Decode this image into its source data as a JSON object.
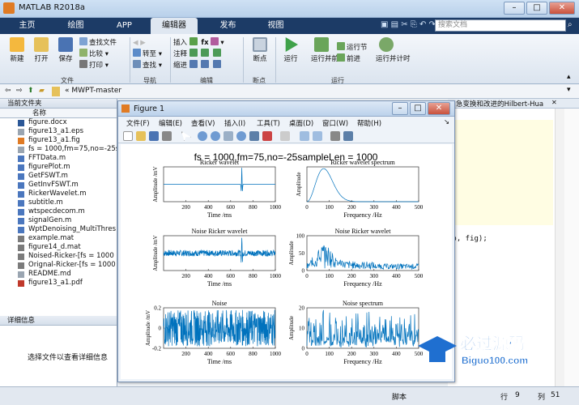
{
  "window": {
    "title": "MATLAB R2018a"
  },
  "ribbon_tabs": [
    {
      "label": "主页"
    },
    {
      "label": "绘图"
    },
    {
      "label": "APP"
    },
    {
      "label": "编辑器"
    },
    {
      "label": "发布"
    },
    {
      "label": "视图"
    }
  ],
  "search": {
    "placeholder": "搜索文档"
  },
  "ribbon": {
    "file": {
      "new": "新建",
      "open": "打开",
      "save": "保存",
      "find_files": "查找文件",
      "compare": "比较",
      "print": "打印",
      "group": "文件"
    },
    "nav": {
      "goto": "转至",
      "find": "查找",
      "group": "导航"
    },
    "edit": {
      "insert": "插入",
      "comment": "注释",
      "indent": "缩进",
      "group": "编辑"
    },
    "breakpoints": {
      "label": "断点",
      "group": "断点"
    },
    "run": {
      "run": "运行",
      "run_advance": "运行并前进",
      "run_section": "运行节",
      "advance": "前进",
      "run_time": "运行并计时",
      "group": "运行"
    }
  },
  "address": {
    "path": "« MWPT-master"
  },
  "current_folder": {
    "title": "当前文件夹",
    "column": "名称",
    "files": [
      {
        "name": "figure.docx",
        "type": "doc"
      },
      {
        "name": "figure13_a1.eps",
        "type": "file"
      },
      {
        "name": "figure13_a1.fig",
        "type": "fig"
      },
      {
        "name": "fs = 1000,fm=75,no=-25s",
        "type": "file"
      },
      {
        "name": "FFTData.m",
        "type": "m"
      },
      {
        "name": "figurePlot.m",
        "type": "m"
      },
      {
        "name": "GetFSWT.m",
        "type": "m"
      },
      {
        "name": "GetInvFSWT.m",
        "type": "m"
      },
      {
        "name": "RickerWavelet.m",
        "type": "m"
      },
      {
        "name": "subtitle.m",
        "type": "m"
      },
      {
        "name": "wtspecdecom.m",
        "type": "m"
      },
      {
        "name": "signalGen.m",
        "type": "m"
      },
      {
        "name": "WptDenoising_MultiThres",
        "type": "m"
      },
      {
        "name": "example.mat",
        "type": "mat"
      },
      {
        "name": "figure14_d.mat",
        "type": "mat"
      },
      {
        "name": "Noised-Ricker-[fs = 1000",
        "type": "mat"
      },
      {
        "name": "Orignal-Ricker-[fs = 1000",
        "type": "mat"
      },
      {
        "name": "README.md",
        "type": "file"
      },
      {
        "name": "figure13_a1.pdf",
        "type": "pdf"
      }
    ]
  },
  "details": {
    "title": "详细信息",
    "hint": "选择文件以查看详细信息"
  },
  "editor": {
    "tab_text": "急变换和改进的Hilbert-Hua",
    "code_fragment": "no, fig);"
  },
  "status": {
    "mode": "脚本",
    "row_label": "行",
    "row": "9",
    "col_label": "列",
    "col": "51"
  },
  "figure": {
    "title": "Figure 1",
    "menu": [
      "文件(F)",
      "编辑(E)",
      "查看(V)",
      "插入(I)",
      "工具(T)",
      "桌面(D)",
      "窗口(W)",
      "帮助(H)"
    ],
    "suptitle": "fs = 1000,fm=75,no=-25sampleLen = 1000"
  },
  "watermark": {
    "text": "必过源码",
    "url": "Biguo100.com"
  },
  "colors": {
    "ribbon_dark": "#1c3b66",
    "plot_line": "#0072bd",
    "accent": "#e07b24"
  },
  "chart_data": [
    {
      "type": "line",
      "title": "Ricker wavelet",
      "xlabel": "Time /ms",
      "ylabel": "Amplitude /mV",
      "xlim": [
        0,
        1000
      ],
      "ylim": [
        -1,
        1
      ],
      "xticks": [
        200,
        400,
        600,
        800,
        1000
      ],
      "yticks": [],
      "signal": "ricker",
      "center": 700
    },
    {
      "type": "line",
      "title": "Ricker wavelet spectrum",
      "xlabel": "Frequency /Hz",
      "ylabel": "Amplitude",
      "xlim": [
        0,
        500
      ],
      "ylim": [
        0,
        1
      ],
      "xticks": [
        0,
        100,
        200,
        300,
        400,
        500
      ],
      "yticks": [],
      "signal": "spectrum",
      "peak_x": 75
    },
    {
      "type": "line",
      "title": "Noise Ricker wavelet",
      "xlabel": "Time /ms",
      "ylabel": "Amplitude /mV",
      "xlim": [
        0,
        1000
      ],
      "ylim": [
        -1,
        1
      ],
      "xticks": [
        200,
        400,
        600,
        800,
        1000
      ],
      "yticks": [],
      "signal": "noisy_ricker",
      "center": 700
    },
    {
      "type": "line",
      "title": "Noise Ricker wavelet",
      "xlabel": "Frequency /Hz",
      "ylabel": "Amplitude",
      "xlim": [
        0,
        500
      ],
      "ylim": [
        0,
        100
      ],
      "xticks": [
        0,
        100,
        200,
        300,
        400,
        500
      ],
      "yticks": [
        0,
        50,
        100
      ],
      "signal": "noisy_spectrum"
    },
    {
      "type": "line",
      "title": "Noise",
      "xlabel": "Time /ms",
      "ylabel": "Amplitude /mV",
      "xlim": [
        0,
        1000
      ],
      "ylim": [
        -0.2,
        0.2
      ],
      "xticks": [
        200,
        400,
        600,
        800,
        1000
      ],
      "yticks": [
        -0.2,
        0,
        0.2
      ],
      "signal": "noise"
    },
    {
      "type": "line",
      "title": "Noise spectrum",
      "xlabel": "Frequency /Hz",
      "ylabel": "Amplitude",
      "xlim": [
        0,
        500
      ],
      "ylim": [
        0,
        20
      ],
      "xticks": [
        0,
        100,
        200,
        300,
        400,
        500
      ],
      "yticks": [
        0,
        10,
        20
      ],
      "signal": "noise_spectrum"
    }
  ]
}
